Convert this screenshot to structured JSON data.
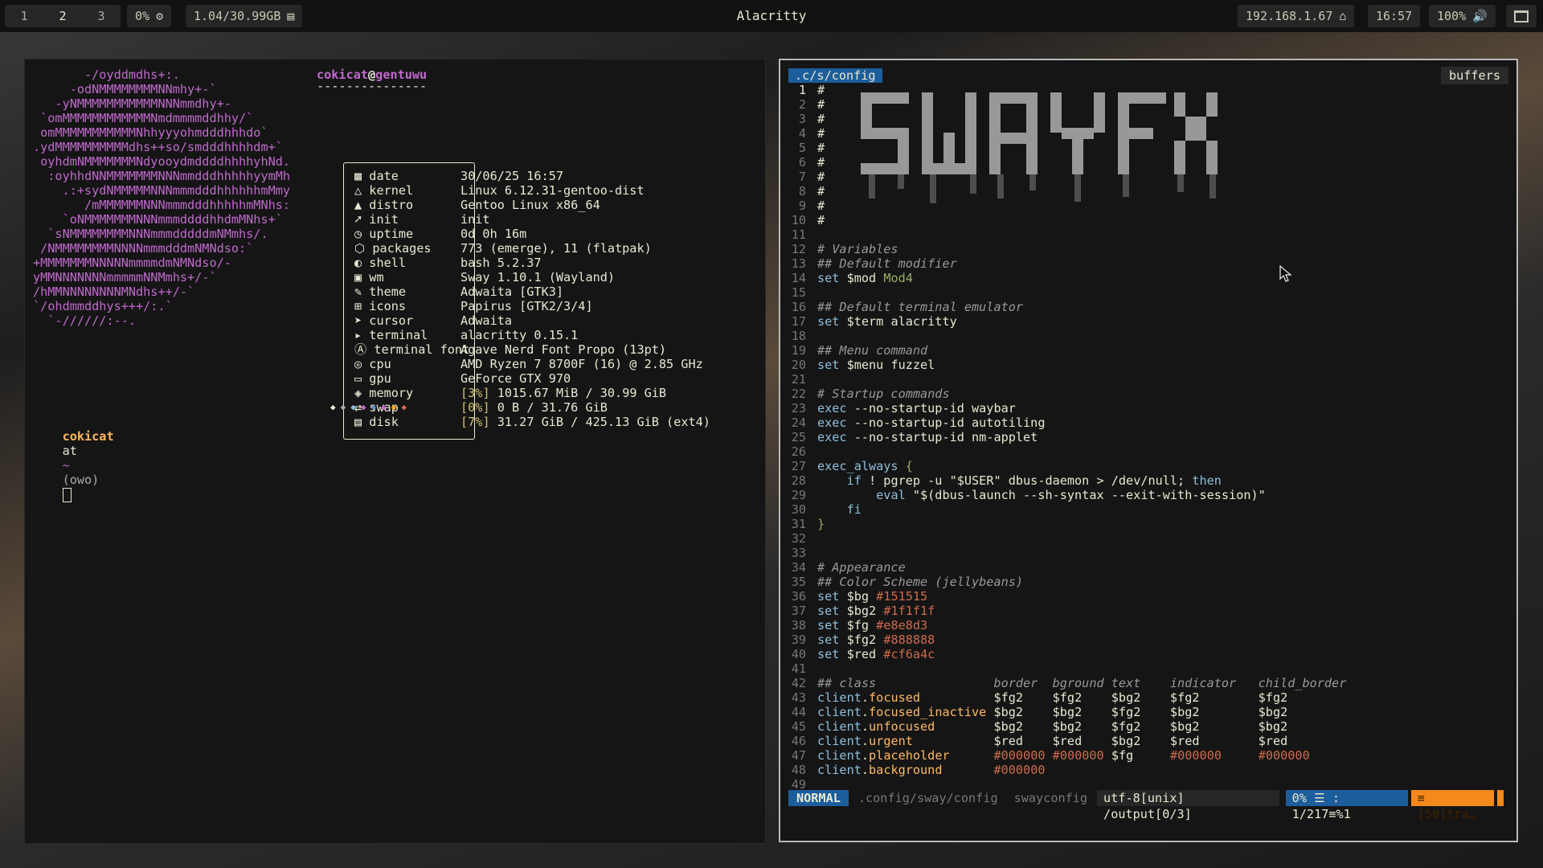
{
  "topbar": {
    "workspaces": [
      "1",
      "2",
      "3"
    ],
    "cpu": "0%",
    "memory": "1.04/30.99GB",
    "window_title": "Alacritty",
    "ip": "192.168.1.67",
    "clock": "16:57",
    "volume": "100%"
  },
  "fetch": {
    "user": "cokicat",
    "host": "gentuwu",
    "separator": "---------------",
    "art": [
      "       -/oyddmdhs+:.",
      "     -odNMMMMMMMMNNmhy+-`",
      "   -yNMMMMMMMMMMMNNNmmdhy+-",
      " `omMMMMMMMMMMMMNmdmmmmddhhy/`",
      " omMMMMMMMMMMMNhhyyyohmdddhhhdo`",
      ".ydMMMMMMMMMMdhs++so/smdddhhhhdm+`",
      " oyhdmNMMMMMMMNdyooydmddddhhhhyhNd.",
      "  :oyhhdNNMMMMMMMNNNmmdddhhhhhyymMh",
      "    .:+sydNMMMMMNNNmmmdddhhhhhhmMmy",
      "       /mMMMMMMNNNmmmdddhhhhhmMNhs:",
      "    `oNMMMMMMMNNNmmmddddhhdmMNhs+`",
      "  `sNMMMMMMMMNNNmmmdddddmNMmhs/.",
      " /NMMMMMMMMNNNNmmmdddmNMNdso:`",
      "+MMMMMMMNNNNNmmmmdmNMNdso/-",
      "yMMNNNNNNNmmmmmNNMmhs+/-`",
      "/hMMNNNNNNNNMNdhs++/-`",
      "`/ohdmmddhys+++/:.`",
      "  `-//////:--."
    ],
    "rows": [
      {
        "icon": "calendar-icon",
        "label": "date",
        "value": "30/06/25 16:57"
      },
      {
        "icon": "kernel-icon",
        "label": "kernel",
        "value": "Linux 6.12.31-gentoo-dist"
      },
      {
        "icon": "distro-icon",
        "label": "distro",
        "value": "Gentoo Linux x86_64"
      },
      {
        "icon": "rocket-icon",
        "label": "init",
        "value": "init"
      },
      {
        "icon": "clock-icon",
        "label": "uptime",
        "value": "0d 0h 16m"
      },
      {
        "icon": "package-icon",
        "label": "packages",
        "value": "773 (emerge), 11 (flatpak)"
      },
      {
        "icon": "shell-icon",
        "label": "shell",
        "value": "bash 5.2.37"
      },
      {
        "icon": "window-icon",
        "label": "wm",
        "value": "Sway 1.10.1 (Wayland)"
      },
      {
        "icon": "brush-icon",
        "label": "theme",
        "value": "Adwaita [GTK3]"
      },
      {
        "icon": "icons-icon",
        "label": "icons",
        "value": "Papirus [GTK2/3/4]"
      },
      {
        "icon": "cursor-icon",
        "label": "cursor",
        "value": "Adwaita"
      },
      {
        "icon": "terminal-icon",
        "label": "terminal",
        "value": "alacritty 0.15.1"
      },
      {
        "icon": "font-icon",
        "label": "terminal font",
        "value": "Agave Nerd Font Propo (13pt)"
      },
      {
        "icon": "cpu-icon",
        "label": "cpu",
        "value": "AMD Ryzen 7 8700F (16) @ 2.85 GHz"
      },
      {
        "icon": "gpu-icon",
        "label": "gpu",
        "value": "GeForce GTX 970"
      },
      {
        "icon": "memory-icon",
        "label": "memory",
        "pct": "3%",
        "value": "1015.67 MiB / 30.99 GiB"
      },
      {
        "icon": "swap-icon",
        "label": "swap",
        "pct": "0%",
        "value": "0 B / 31.76 GiB"
      },
      {
        "icon": "disk-icon",
        "label": "disk",
        "pct": "7%",
        "value": "31.27 GiB / 425.13 GiB (ext4)"
      }
    ],
    "color_dots": [
      "#e8e8d3",
      "#aaaaaa",
      "#8fbfdc",
      "#c06acd",
      "#5a8fcf",
      "#c06acd",
      "#f5a623",
      "#cf6a4c"
    ],
    "prompt_user": "cokicat",
    "prompt_at": "at",
    "prompt_dir": "~",
    "prompt_face": "(owo)"
  },
  "vim": {
    "tab": ".c/s/config",
    "buffers_label": "buffers",
    "lines": [
      {
        "n": "1",
        "t": "#"
      },
      {
        "n": "2",
        "t": "#"
      },
      {
        "n": "3",
        "t": "#"
      },
      {
        "n": "4",
        "t": "#"
      },
      {
        "n": "5",
        "t": "#"
      },
      {
        "n": "6",
        "t": "#"
      },
      {
        "n": "7",
        "t": "#"
      },
      {
        "n": "8",
        "t": "#"
      },
      {
        "n": "9",
        "t": "#"
      },
      {
        "n": "10",
        "t": "#"
      },
      {
        "n": "11",
        "t": ""
      },
      {
        "n": "12",
        "t": "# Variables"
      },
      {
        "n": "13",
        "t": "## Default modifier"
      },
      {
        "n": "14",
        "t": "set $mod Mod4"
      },
      {
        "n": "15",
        "t": ""
      },
      {
        "n": "16",
        "t": "## Default terminal emulator"
      },
      {
        "n": "17",
        "t": "set $term alacritty"
      },
      {
        "n": "18",
        "t": ""
      },
      {
        "n": "19",
        "t": "## Menu command"
      },
      {
        "n": "20",
        "t": "set $menu fuzzel"
      },
      {
        "n": "21",
        "t": ""
      },
      {
        "n": "22",
        "t": "# Startup commands"
      },
      {
        "n": "23",
        "t": "exec --no-startup-id waybar"
      },
      {
        "n": "24",
        "t": "exec --no-startup-id autotiling"
      },
      {
        "n": "25",
        "t": "exec --no-startup-id nm-applet"
      },
      {
        "n": "26",
        "t": ""
      },
      {
        "n": "27",
        "t": "exec_always {"
      },
      {
        "n": "28",
        "t": "    if ! pgrep -u \"$USER\" dbus-daemon > /dev/null; then"
      },
      {
        "n": "29",
        "t": "        eval \"$(dbus-launch --sh-syntax --exit-with-session)\""
      },
      {
        "n": "30",
        "t": "    fi"
      },
      {
        "n": "31",
        "t": "}"
      },
      {
        "n": "32",
        "t": ""
      },
      {
        "n": "33",
        "t": ""
      },
      {
        "n": "34",
        "t": "# Appearance"
      },
      {
        "n": "35",
        "t": "## Color Scheme (jellybeans)"
      },
      {
        "n": "36",
        "t": "set $bg #151515"
      },
      {
        "n": "37",
        "t": "set $bg2 #1f1f1f"
      },
      {
        "n": "38",
        "t": "set $fg #e8e8d3"
      },
      {
        "n": "39",
        "t": "set $fg2 #888888"
      },
      {
        "n": "40",
        "t": "set $red #cf6a4c"
      },
      {
        "n": "41",
        "t": ""
      },
      {
        "n": "42",
        "t": "## class                border  bground text    indicator   child_border"
      },
      {
        "n": "43",
        "t": "client.focused          $fg2    $fg2    $bg2    $fg2        $fg2"
      },
      {
        "n": "44",
        "t": "client.focused_inactive $bg2    $bg2    $fg2    $bg2        $bg2"
      },
      {
        "n": "45",
        "t": "client.unfocused        $bg2    $bg2    $fg2    $bg2        $bg2"
      },
      {
        "n": "46",
        "t": "client.urgent           $red    $red    $bg2    $red        $red"
      },
      {
        "n": "47",
        "t": "client.placeholder      #000000 #000000 $fg     #000000     #000000"
      },
      {
        "n": "48",
        "t": "client.background       #000000"
      },
      {
        "n": "49",
        "t": ""
      }
    ],
    "status": {
      "mode": "NORMAL",
      "file": ".config/sway/config",
      "filetype": "swayconfig",
      "encoding": "utf-8[unix] /output[0/3]",
      "position": "0% ☰ : 1/217≡%1",
      "warning": "≡ [50]tra…"
    }
  }
}
